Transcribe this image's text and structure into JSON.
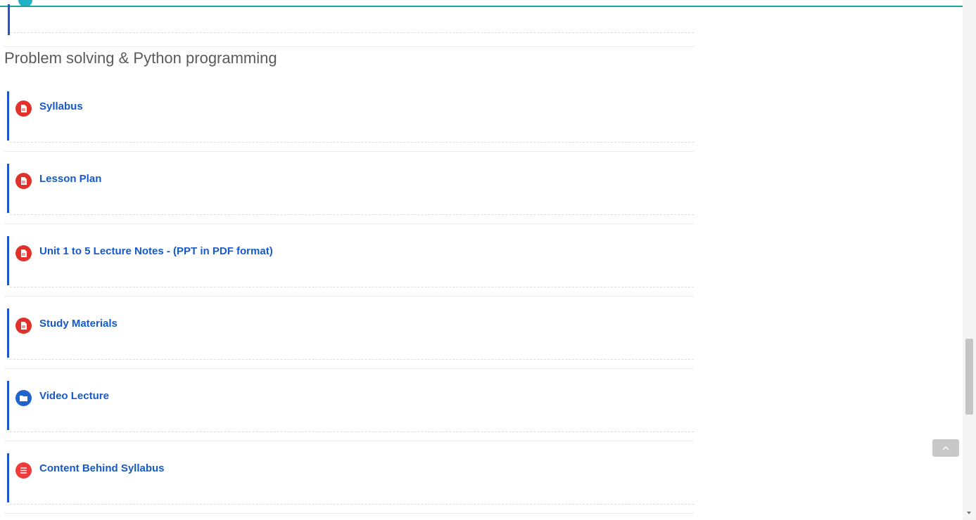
{
  "section": {
    "title": "Problem solving & Python programming"
  },
  "items": [
    {
      "label": "Syllabus",
      "icon": "pdf-file-icon"
    },
    {
      "label": "Lesson Plan",
      "icon": "pdf-file-icon"
    },
    {
      "label": "Unit 1 to 5 Lecture Notes - (PPT in PDF format)",
      "icon": "pdf-file-icon"
    },
    {
      "label": "Study Materials",
      "icon": "pdf-file-icon"
    },
    {
      "label": "Video Lecture",
      "icon": "folder-icon"
    },
    {
      "label": "Content Behind Syllabus",
      "icon": "page-icon"
    }
  ],
  "colors": {
    "accent_teal": "#1aa39a",
    "link_blue": "#1659c8",
    "pdf_red": "#e0312b",
    "folder_blue": "#1f63cc",
    "page_red": "#ef3b3b",
    "bar_blue": "#1f56c9"
  },
  "back_to_top": {
    "icon": "chevron-up-icon"
  }
}
